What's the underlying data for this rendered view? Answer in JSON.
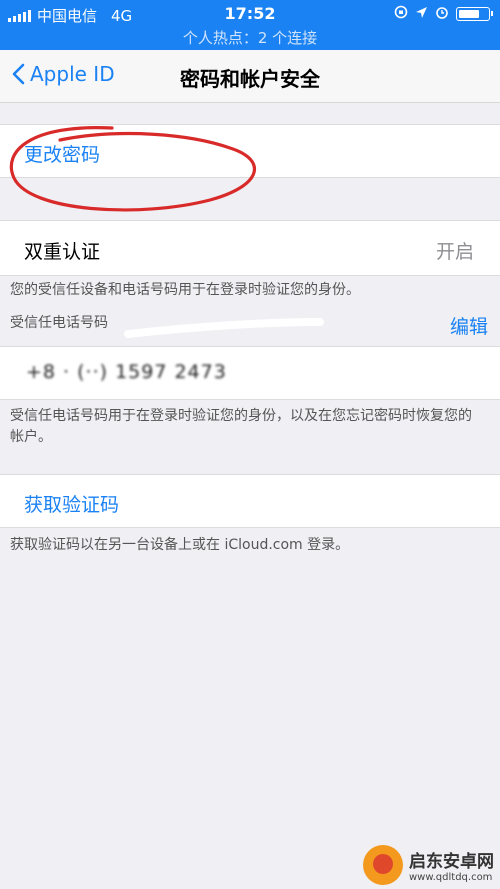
{
  "status_bar": {
    "carrier": "中国电信",
    "network": "4G",
    "time": "17:52",
    "hotspot": "个人热点：2 个连接",
    "battery_level": 0.75
  },
  "nav": {
    "back_label": "Apple ID",
    "title": "密码和帐户安全"
  },
  "change_password": {
    "label": "更改密码"
  },
  "two_factor": {
    "label": "双重认证",
    "value": "开启",
    "footnote": "您的受信任设备和电话号码用于在登录时验证您的身份。"
  },
  "trusted_numbers": {
    "header": "受信任电话号码",
    "edit_label": "编辑",
    "number": "+8 · (··) 1597 2473",
    "footnote": "受信任电话号码用于在登录时验证您的身份，以及在您忘记密码时恢复您的帐户。"
  },
  "verification_code": {
    "label": "获取验证码",
    "footnote": "获取验证码以在另一台设备上或在 iCloud.com 登录。"
  },
  "watermark": {
    "name": "启东安卓网",
    "url": "www.qdltdq.com"
  },
  "colors": {
    "accent": "#1a82f3",
    "annotation": "#d92a2a"
  }
}
